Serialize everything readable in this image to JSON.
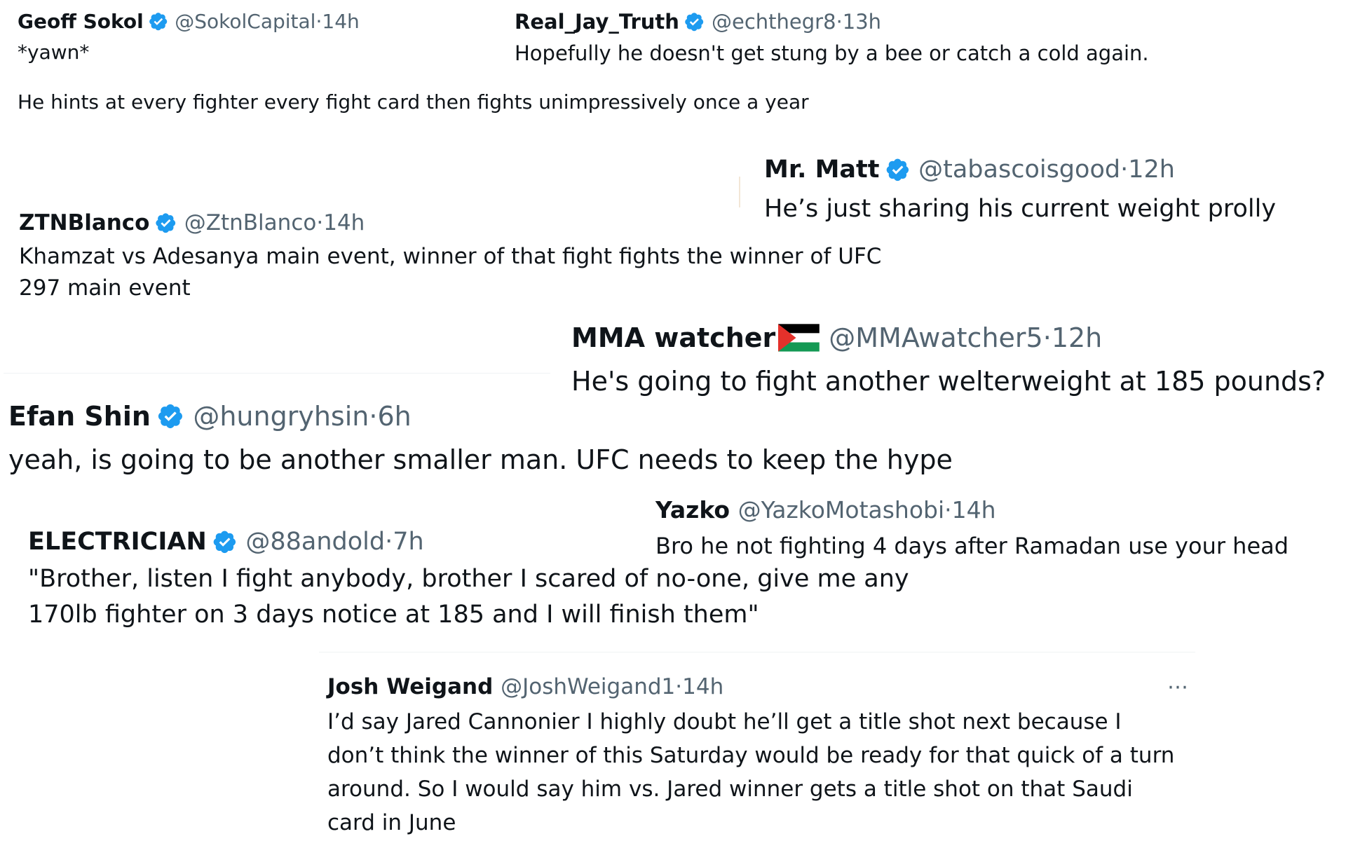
{
  "tweets": [
    {
      "name": "Geoff Sokol",
      "handle": "@SokolCapital",
      "time": "14h",
      "text": "*yawn*",
      "text2": "He hints at every fighter every fight card then fights unimpressively once a year"
    },
    {
      "name": "Real_Jay_Truth",
      "handle": "@echthegr8",
      "time": "13h",
      "text": "Hopefully he doesn't get stung by a bee or catch a cold again."
    },
    {
      "name": "Mr. Matt",
      "handle": "@tabascoisgood",
      "time": "12h",
      "text": "He’s just sharing his current weight prolly"
    },
    {
      "name": "ZTNBlanco",
      "handle": "@ZtnBlanco",
      "time": "14h",
      "text": "Khamzat vs Adesanya main event, winner of that fight fights the winner of UFC 297 main event"
    },
    {
      "name": "MMA watcher",
      "handle": "@MMAwatcher5",
      "time": "12h",
      "text": "He's going to fight another welterweight at 185 pounds?"
    },
    {
      "name": "Efan Shin",
      "handle": "@hungryhsin",
      "time": "6h",
      "text": "yeah, is going to be another smaller man. UFC needs to keep the hype"
    },
    {
      "name": "Yazko",
      "handle": "@YazkoMotashobi",
      "time": "14h",
      "text": "Bro he not fighting 4 days after Ramadan use your head"
    },
    {
      "name": "ELECTRICIAN",
      "handle": "@88andold",
      "time": "7h",
      "text": "\"Brother, listen I fight anybody, brother I scared of no-one, give me any 170lb fighter on 3 days notice at 185 and I will finish them\""
    },
    {
      "name": "Josh Weigand",
      "handle": "@JoshWeigand1",
      "time": "14h",
      "text": "I’d say Jared Cannonier I highly doubt he’ll get a title shot next because I don’t think the winner of this Saturday would be ready for that quick of a turn around. So I would say him vs. Jared winner gets a title shot on that Saudi card in June"
    }
  ],
  "separator": " · ",
  "colors": {
    "verified": "#1d9bf0",
    "text": "#0f1419",
    "meta": "#536471"
  },
  "icons": {
    "verified": "verified-badge-icon",
    "flag": "palestine-flag-icon",
    "more": "more-options-icon"
  }
}
